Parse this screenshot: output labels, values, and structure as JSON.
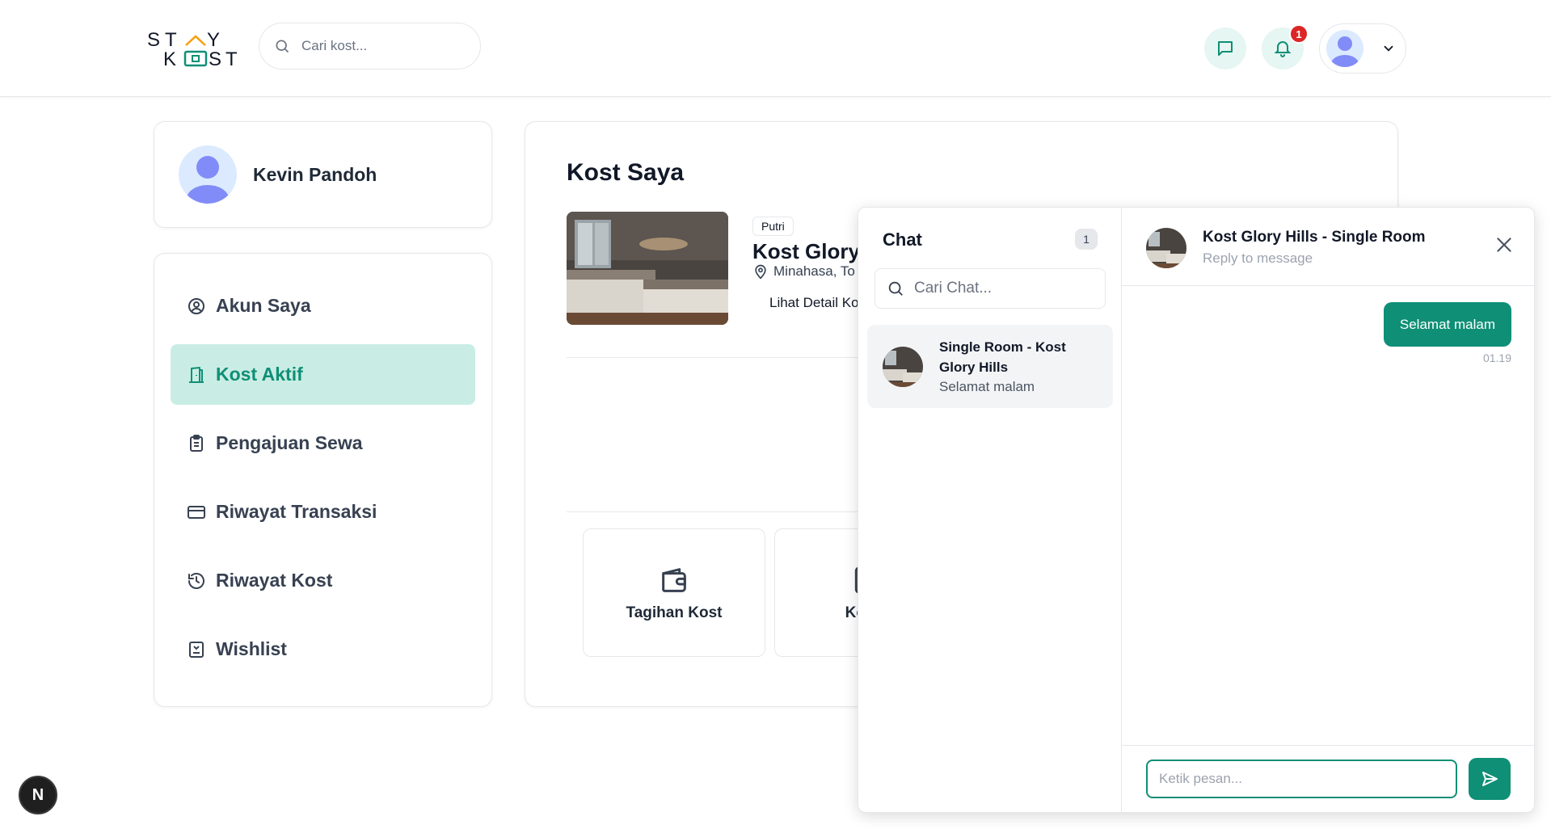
{
  "header": {
    "logo_text": "STAY KOST",
    "search": {
      "placeholder": "Cari kost..."
    },
    "notification_count": "1",
    "icons": {
      "chat": "chat-bubble-icon",
      "notification": "bell-icon",
      "profile": "user-avatar",
      "chevron": "chevron-down-icon"
    }
  },
  "profile": {
    "name": "Kevin Pandoh"
  },
  "menu": {
    "items": [
      {
        "label": "Akun Saya",
        "icon": "user-circle-icon"
      },
      {
        "label": "Kost Aktif",
        "icon": "building-door-icon",
        "active": true
      },
      {
        "label": "Pengajuan Sewa",
        "icon": "clipboard-icon"
      },
      {
        "label": "Riwayat Transaksi",
        "icon": "credit-card-icon"
      },
      {
        "label": "Riwayat Kost",
        "icon": "history-icon"
      },
      {
        "label": "Wishlist",
        "icon": "bookmark-icon"
      }
    ]
  },
  "main": {
    "title": "Kost Saya",
    "kost": {
      "tag": "Putri",
      "name": "Kost Glory",
      "location": "Minahasa, To",
      "detail_link": "Lihat Detail Ko"
    },
    "actions": [
      {
        "label": "Tagihan Kost",
        "icon": "wallet-icon"
      },
      {
        "label": "Kontr",
        "icon": "document-icon"
      }
    ]
  },
  "chat": {
    "title": "Chat",
    "count": "1",
    "search_placeholder": "Cari Chat...",
    "conversations": [
      {
        "name": "Single Room - Kost Glory Hills",
        "last_message": "Selamat malam"
      }
    ],
    "active": {
      "title": "Kost Glory Hills - Single Room",
      "subtitle": "Reply to message",
      "messages": [
        {
          "text": "Selamat malam",
          "time": "01.19",
          "from": "me"
        }
      ],
      "input_placeholder": "Ketik pesan..."
    }
  },
  "dev_badge": "N",
  "colors": {
    "primary": "#0f8f76",
    "active_bg": "#c9ede4",
    "badge": "#dc2626"
  }
}
